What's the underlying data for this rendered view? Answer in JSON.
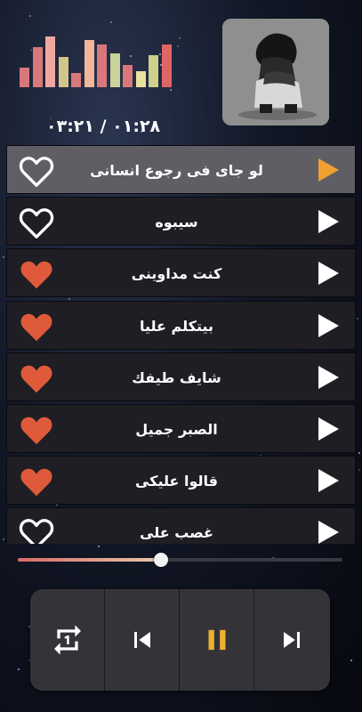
{
  "player": {
    "time_readout": "٠١:٢٨ / ٠٣:٢١",
    "progress": 0.44
  },
  "equalizer": {
    "levels": [
      0.35,
      0.72,
      0.92,
      0.55,
      0.26,
      0.86,
      0.78,
      0.62,
      0.4,
      0.29,
      0.58,
      0.78
    ],
    "colors": [
      "#d9787a",
      "#d9787a",
      "#f0a7a2",
      "#d4c58a",
      "#d9787a",
      "#f2b79b",
      "#d9787a",
      "#c9d39a",
      "#d9787a",
      "#e9e29f",
      "#cfd08b",
      "#e06666"
    ]
  },
  "songs": [
    {
      "title": "لو جاى فى رجوع انسانى",
      "liked": false,
      "active": true
    },
    {
      "title": "سيبوه",
      "liked": false,
      "active": false
    },
    {
      "title": "كنت مداوينى",
      "liked": true,
      "active": false
    },
    {
      "title": "بيتكلم عليا",
      "liked": true,
      "active": false
    },
    {
      "title": "شايف طيفك",
      "liked": true,
      "active": false
    },
    {
      "title": "الصبر جميل",
      "liked": true,
      "active": false
    },
    {
      "title": "قالوا عليكى",
      "liked": true,
      "active": false
    },
    {
      "title": "غصب على",
      "liked": false,
      "active": false
    }
  ],
  "colors": {
    "accent": "#f0a030",
    "heart_filled": "#de5a3a",
    "play_icon": "#ffffff",
    "pause_icon": "#f0b030"
  },
  "icons": {
    "repeat": "repeat-one-icon",
    "previous": "skip-previous-icon",
    "pause": "pause-icon",
    "next": "skip-next-icon",
    "heart": "heart-icon",
    "play": "play-icon"
  }
}
